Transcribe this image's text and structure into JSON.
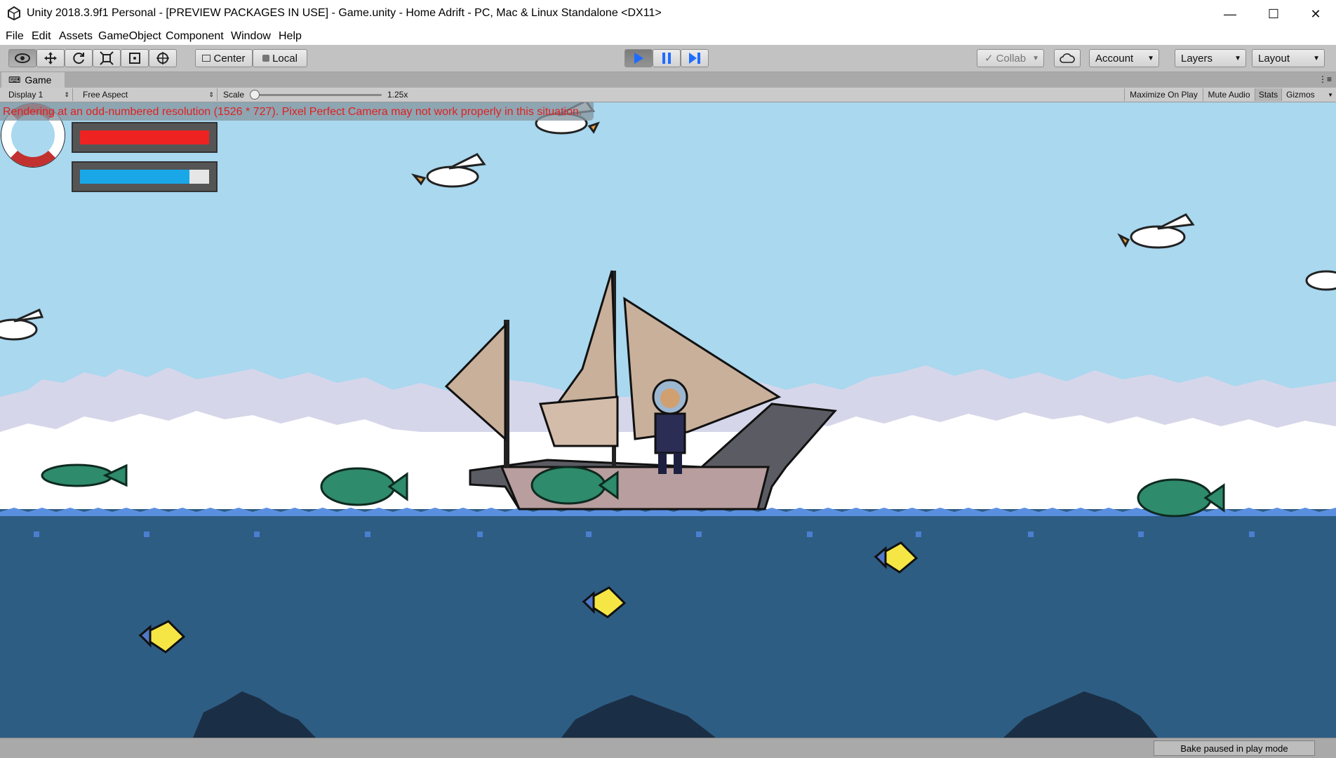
{
  "window": {
    "title": "Unity 2018.3.9f1 Personal - [PREVIEW PACKAGES IN USE] - Game.unity - Home Adrift - PC, Mac & Linux Standalone <DX11>"
  },
  "menu": [
    "File",
    "Edit",
    "Assets",
    "GameObject",
    "Component",
    "Window",
    "Help"
  ],
  "toolbar": {
    "pivot_label": "Center",
    "space_label": "Local",
    "collab_label": "Collab",
    "account_label": "Account",
    "layers_label": "Layers",
    "layout_label": "Layout"
  },
  "game_view": {
    "tab_label": "Game",
    "display_label": "Display 1",
    "aspect_label": "Free Aspect",
    "scale_label": "Scale",
    "scale_value": "1.25x",
    "scale_level": 0.0,
    "maximize_label": "Maximize On Play",
    "mute_label": "Mute Audio",
    "stats_label": "Stats",
    "gizmos_label": "Gizmos",
    "warning_text": "Rendering at an odd-numbered resolution (1526 * 727). Pixel Perfect Camera may not work properly in this situation."
  },
  "hud": {
    "health_fill": 1.0,
    "water_fill": 0.85,
    "health_color": "#ef2222",
    "water_color": "#1aa7e8"
  },
  "status": {
    "bake_text": "Bake paused in play mode"
  },
  "icons": [
    "unity-logo-icon",
    "minimize-icon",
    "maximize-icon",
    "close-icon",
    "eye-icon",
    "move-icon",
    "rotate-icon",
    "scale-icon",
    "rect-icon",
    "transform-icon",
    "play-icon",
    "pause-icon",
    "step-icon",
    "cloud-icon",
    "check-icon"
  ]
}
